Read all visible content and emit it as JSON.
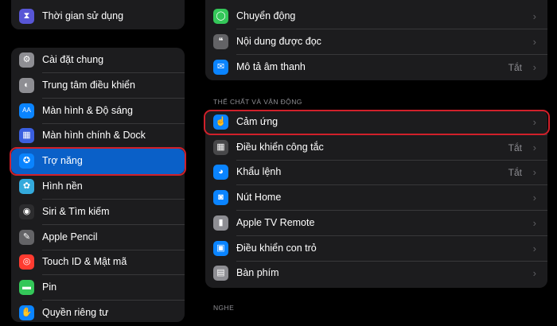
{
  "sidebar": {
    "top_item": {
      "label": "Thời gian sử dụng",
      "icon": "hourglass-icon",
      "color": "#5856d6"
    },
    "items": [
      {
        "label": "Cài đặt chung",
        "icon": "gear-icon",
        "color": "#8e8e93"
      },
      {
        "label": "Trung tâm điều khiển",
        "icon": "toggles-icon",
        "color": "#8e8e93"
      },
      {
        "label": "Màn hình & Độ sáng",
        "icon": "text-size-icon",
        "color": "#0a84ff"
      },
      {
        "label": "Màn hình chính & Dock",
        "icon": "home-grid-icon",
        "color": "#3a5fe0"
      },
      {
        "label": "Trợ năng",
        "icon": "accessibility-icon",
        "color": "#0a84ff",
        "selected": true
      },
      {
        "label": "Hình nền",
        "icon": "flower-icon",
        "color": "#34aadc"
      },
      {
        "label": "Siri & Tìm kiếm",
        "icon": "siri-icon",
        "color": "#2c2c2e"
      },
      {
        "label": "Apple Pencil",
        "icon": "pencil-icon",
        "color": "#636366"
      },
      {
        "label": "Touch ID & Mật mã",
        "icon": "fingerprint-icon",
        "color": "#ff3b30"
      },
      {
        "label": "Pin",
        "icon": "battery-icon",
        "color": "#34c759"
      },
      {
        "label": "Quyền riêng tư",
        "icon": "hand-icon",
        "color": "#0a84ff"
      }
    ]
  },
  "main": {
    "vision_rows": [
      {
        "label": "Chuyển động",
        "icon": "motion-icon",
        "color": "#34c759",
        "value": ""
      },
      {
        "label": "Nội dung được đọc",
        "icon": "speech-bubble-icon",
        "color": "#636366",
        "value": ""
      },
      {
        "label": "Mô tả âm thanh",
        "icon": "audio-description-icon",
        "color": "#0a84ff",
        "value": "Tắt"
      }
    ],
    "physical_header": "THỂ CHẤT VÀ VẬN ĐỘNG",
    "physical_rows": [
      {
        "label": "Cảm ứng",
        "icon": "touch-hand-icon",
        "color": "#0a84ff",
        "value": ""
      },
      {
        "label": "Điều khiển công tắc",
        "icon": "switch-grid-icon",
        "color": "#48484a",
        "value": "Tắt"
      },
      {
        "label": "Khẩu lệnh",
        "icon": "voice-control-icon",
        "color": "#0a84ff",
        "value": "Tắt"
      },
      {
        "label": "Nút Home",
        "icon": "home-button-icon",
        "color": "#0a84ff",
        "value": ""
      },
      {
        "label": "Apple TV Remote",
        "icon": "remote-icon",
        "color": "#8e8e93",
        "value": ""
      },
      {
        "label": "Điều khiển con trỏ",
        "icon": "pointer-icon",
        "color": "#0a84ff",
        "value": ""
      },
      {
        "label": "Bàn phím",
        "icon": "keyboard-icon",
        "color": "#8e8e93",
        "value": ""
      }
    ],
    "hearing_header": "NGHE"
  },
  "chevron_glyph": "›",
  "accent": "#0a60c8",
  "highlight": "#d0202a"
}
